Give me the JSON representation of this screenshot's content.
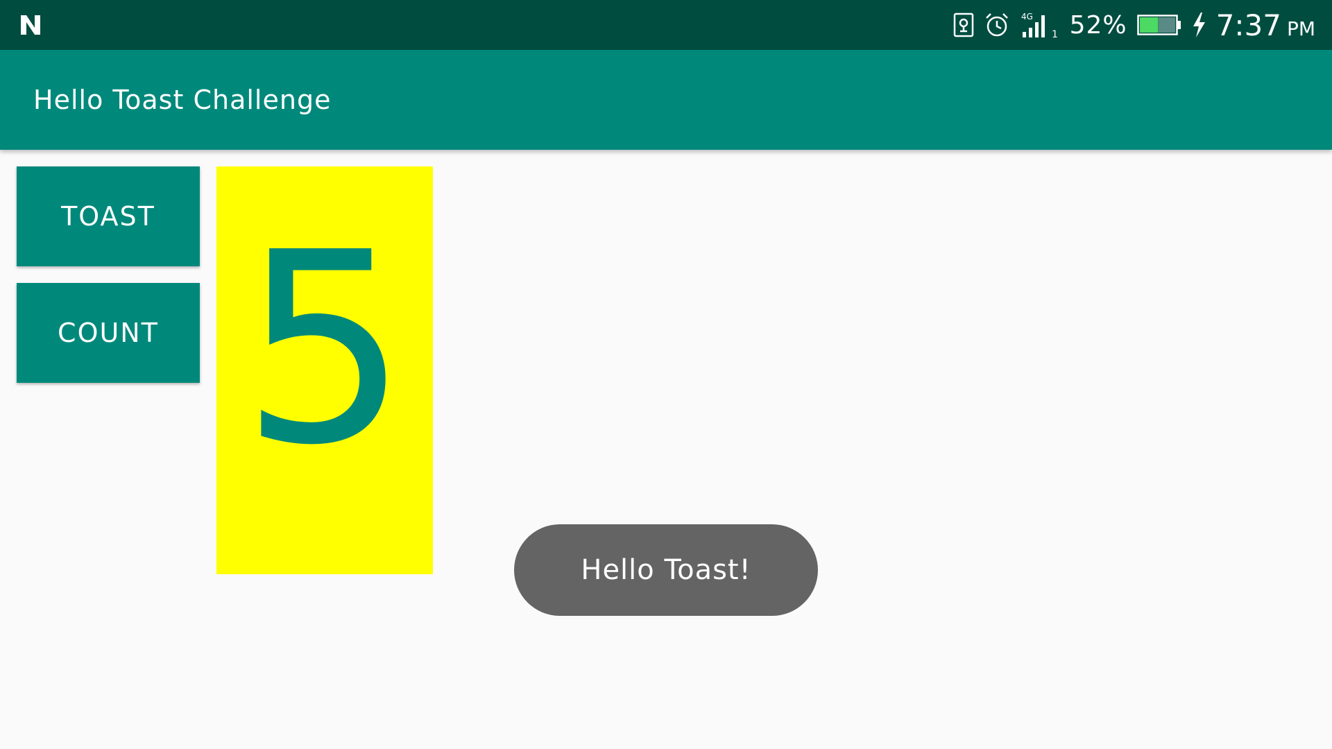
{
  "status_bar": {
    "battery_percent": "52%",
    "battery_level": 0.52,
    "time": "7:37",
    "ampm": "PM",
    "signal_label": "4G",
    "sim_index": "1",
    "icons": [
      "n-logo-icon",
      "sim-card-icon",
      "alarm-icon",
      "signal-4g-icon",
      "battery-icon",
      "charging-bolt-icon"
    ]
  },
  "app_bar": {
    "title": "Hello Toast Challenge"
  },
  "buttons": {
    "toast_label": "TOAST",
    "count_label": "COUNT"
  },
  "count": {
    "value": "5"
  },
  "toast": {
    "message": "Hello Toast!"
  },
  "colors": {
    "status_bar": "#004d40",
    "primary": "#00897b",
    "count_background": "#ffff00",
    "toast_background": "#646464",
    "battery_fill": "#4cd964"
  }
}
